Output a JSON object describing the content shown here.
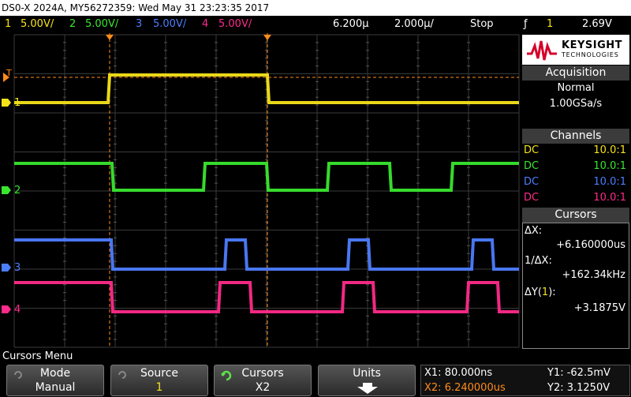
{
  "title": "DS0-X 2024A, MY56272359: Wed May 31 23:23:35 2017",
  "status": {
    "ch1_num": "1",
    "ch1_scale": "5.00V/",
    "ch2_num": "2",
    "ch2_scale": "5.00V/",
    "ch3_num": "3",
    "ch3_scale": "5.00V/",
    "ch4_num": "4",
    "ch4_scale": "5.00V/",
    "delay": "6.200µ",
    "timebase": "2.000µ/",
    "run_state": "Stop",
    "trigger_symbol": "ƒ",
    "trigger_channel": "1",
    "trigger_level": "2.69V"
  },
  "colors": {
    "ch1": "#f5e31a",
    "ch2": "#39e62e",
    "ch3": "#4d7dff",
    "ch4": "#ff2a8a",
    "cursor": "#ff8c1a",
    "grid": "#3a3a3a"
  },
  "waveform_labels": {
    "trigger_marker": "T",
    "ch1": "1",
    "ch2": "2",
    "ch3": "3",
    "ch4": "4"
  },
  "brand": {
    "name": "KEYSIGHT",
    "sub": "TECHNOLOGIES"
  },
  "acquisition": {
    "header": "Acquisition",
    "mode": "Normal",
    "rate": "1.00GSa/s"
  },
  "channels": {
    "header": "Channels",
    "rows": [
      {
        "coupling": "DC",
        "probe": "10.0:1"
      },
      {
        "coupling": "DC",
        "probe": "10.0:1"
      },
      {
        "coupling": "DC",
        "probe": "10.0:1"
      },
      {
        "coupling": "DC",
        "probe": "10.0:1"
      }
    ]
  },
  "cursors_panel": {
    "header": "Cursors",
    "dx_label": "ΔX:",
    "dx_value": "+6.160000us",
    "inv_dx_label": "1/ΔX:",
    "inv_dx_value": "+162.34kHz",
    "dy_label": "ΔY(",
    "dy_channel": "1",
    "dy_label_end": "):",
    "dy_value": "+3.1875V"
  },
  "menu": {
    "title": "Cursors Menu",
    "softkeys": [
      {
        "label": "Mode",
        "value": "Manual"
      },
      {
        "label": "Source",
        "value": "1"
      },
      {
        "label": "Cursors",
        "value": "X2"
      },
      {
        "label": "Units",
        "value": ""
      }
    ]
  },
  "cursor_readout": {
    "x1": "X1: 80.000ns",
    "x2": "X2: 6.240000us",
    "y1": "Y1: -62.5mV",
    "y2": "Y2: 3.1250V"
  },
  "icons": {
    "rotate": "rotate-knob-icon",
    "down_arrow": "down-arrow-icon",
    "trigger_edge": "rising-edge-icon"
  }
}
